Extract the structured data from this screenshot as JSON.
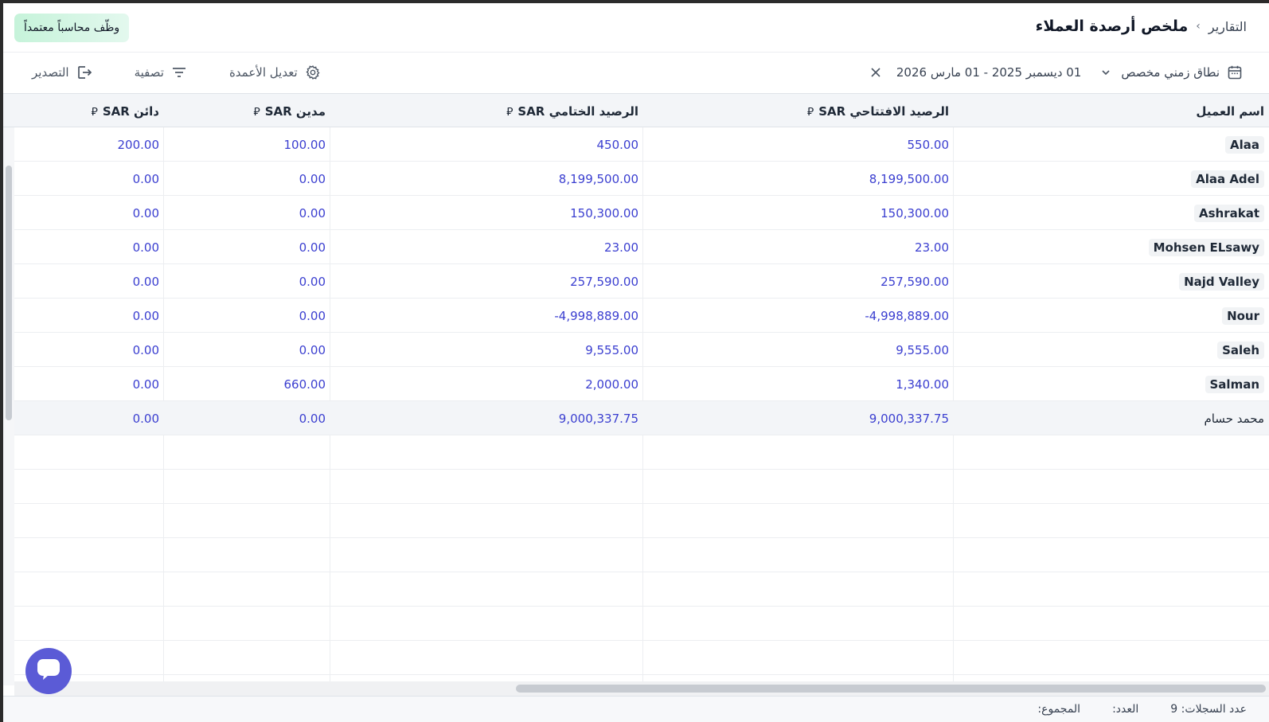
{
  "header": {
    "breadcrumb_parent": "التقارير",
    "breadcrumb_separator": "›",
    "title": "ملخص أرصدة العملاء",
    "hire_button": "وظّف محاسباً معتمداً"
  },
  "toolbar": {
    "range_label": "نطاق زمني مخصص",
    "range_dates": "01 ديسمبر 2025 - 01 مارس 2026",
    "edit_columns": "تعديل الأعمدة",
    "filter": "تصفية",
    "export": "التصدير"
  },
  "table": {
    "currency_symbol": "⃁",
    "headers": {
      "name": "اسم العميل",
      "opening": "الرصيد الافتتاحي SAR",
      "closing": "الرصيد الختامي SAR",
      "debit": "مدين SAR",
      "credit": "دائن SAR"
    },
    "rows": [
      {
        "name": "Alaa",
        "opening": "550.00",
        "closing": "450.00",
        "debit": "100.00",
        "credit": "200.00"
      },
      {
        "name": "Alaa Adel",
        "opening": "8,199,500.00",
        "closing": "8,199,500.00",
        "debit": "0.00",
        "credit": "0.00"
      },
      {
        "name": "Ashrakat",
        "opening": "150,300.00",
        "closing": "150,300.00",
        "debit": "0.00",
        "credit": "0.00"
      },
      {
        "name": "Mohsen ELsawy",
        "opening": "23.00",
        "closing": "23.00",
        "debit": "0.00",
        "credit": "0.00"
      },
      {
        "name": "Najd Valley",
        "opening": "257,590.00",
        "closing": "257,590.00",
        "debit": "0.00",
        "credit": "0.00"
      },
      {
        "name": "Nour",
        "opening": "-4,998,889.00",
        "closing": "-4,998,889.00",
        "debit": "0.00",
        "credit": "0.00"
      },
      {
        "name": "Saleh",
        "opening": "9,555.00",
        "closing": "9,555.00",
        "debit": "0.00",
        "credit": "0.00"
      },
      {
        "name": "Salman",
        "opening": "1,340.00",
        "closing": "2,000.00",
        "debit": "660.00",
        "credit": "0.00"
      }
    ],
    "total_row": {
      "name": "محمد حسام",
      "opening": "9,000,337.75",
      "closing": "9,000,337.75",
      "debit": "0.00",
      "credit": "0.00"
    }
  },
  "footer": {
    "records_count": "عدد السجلات: 9",
    "count_label": "العدد:",
    "sum_label": "المجموع:"
  },
  "colors": {
    "accent": "#5b5bd6",
    "value_text": "#3b3fd0",
    "header_bg": "#f3f5f8"
  }
}
